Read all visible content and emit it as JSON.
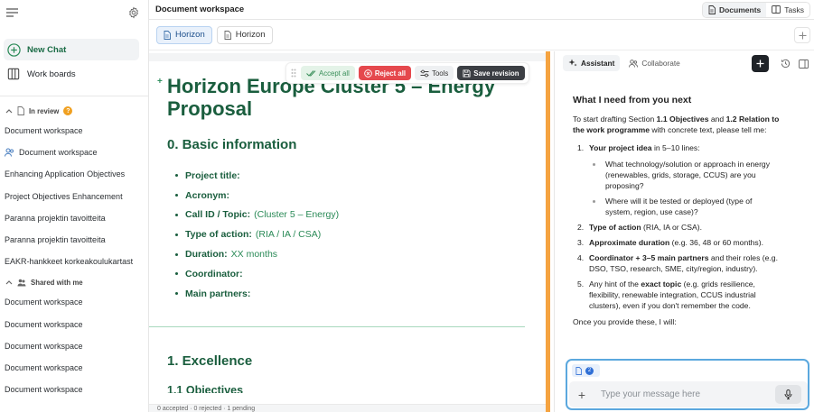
{
  "sidebar": {
    "new_chat": "New Chat",
    "work_boards": "Work boards",
    "in_review": {
      "title": "In review",
      "badge": "?",
      "items": [
        {
          "label": "Document workspace",
          "shared": false
        },
        {
          "label": "Document workspace",
          "shared": true
        },
        {
          "label": "Enhancing Application Objectives",
          "shared": false
        },
        {
          "label": "Project Objectives Enhancement",
          "shared": false
        },
        {
          "label": "Paranna projektin tavoitteita",
          "shared": false
        },
        {
          "label": "Paranna projektin tavoitteita",
          "shared": false
        },
        {
          "label": "EAKR-hankkeet korkeakoulukartast",
          "shared": false
        }
      ]
    },
    "shared_with_me": {
      "title": "Shared with me",
      "items": [
        "Document workspace",
        "Document workspace",
        "Document workspace",
        "Document workspace",
        "Document workspace"
      ]
    }
  },
  "header": {
    "title": "Document workspace",
    "documents": "Documents",
    "tasks": "Tasks"
  },
  "tabs": [
    "Horizon",
    "Horizon"
  ],
  "toolbar": {
    "accept_all": "Accept all",
    "reject_all": "Reject all",
    "tools": "Tools",
    "save_revision": "Save revision"
  },
  "document": {
    "title": "Horizon Europe Cluster 5 – Energy Proposal",
    "section0": "0. Basic information",
    "fields": [
      {
        "key": "Project title:",
        "value": ""
      },
      {
        "key": "Acronym:",
        "value": ""
      },
      {
        "key": "Call ID / Topic:",
        "value": "(Cluster 5 – Energy)"
      },
      {
        "key": "Type of action:",
        "value": "(RIA / IA / CSA)"
      },
      {
        "key": "Duration:",
        "value": "XX months"
      },
      {
        "key": "Coordinator:",
        "value": ""
      },
      {
        "key": "Main partners:",
        "value": ""
      }
    ],
    "section1": "1. Excellence",
    "subsection": "1.1 Objectives"
  },
  "status": "0 accepted · 0 rejected · 1 pending",
  "panel": {
    "tab_assistant": "Assistant",
    "tab_collaborate": "Collaborate",
    "heading": "What I need from you next",
    "intro_pre": "To start drafting Section ",
    "intro_b1": "1.1 Objectives",
    "intro_mid": " and ",
    "intro_b2": "1.2 Relation to the work programme",
    "intro_post": " with concrete text, please tell me:",
    "items": [
      {
        "num": "1.",
        "bold": "Your project idea",
        "text": " in 5–10 lines:"
      },
      {
        "num": "2.",
        "bold": "Type of action",
        "text": " (RIA, IA or CSA)."
      },
      {
        "num": "3.",
        "bold": "Approximate duration",
        "text": " (e.g. 36, 48 or 60 months)."
      },
      {
        "num": "4.",
        "bold": "Coordinator + 3–5 main partners",
        "text": " and their roles (e.g. DSO, TSO, research, SME, city/region, industry)."
      },
      {
        "num": "5.",
        "bold": "",
        "text": ""
      }
    ],
    "subitems": [
      "What technology/solution or approach in energy (renewables, grids, storage, CCUS) are you proposing?",
      "Where will it be tested or deployed (type of system, region, use case)?"
    ],
    "item5_pre": "Any hint of the ",
    "item5_bold": "exact topic",
    "item5_post": " (e.g. grids resilience, flexibility, renewable integration, CCUS industrial clusters), even if you don't remember the code.",
    "outro": "Once you provide these, I will:",
    "chip_count": "2",
    "placeholder": "Type your message here"
  }
}
